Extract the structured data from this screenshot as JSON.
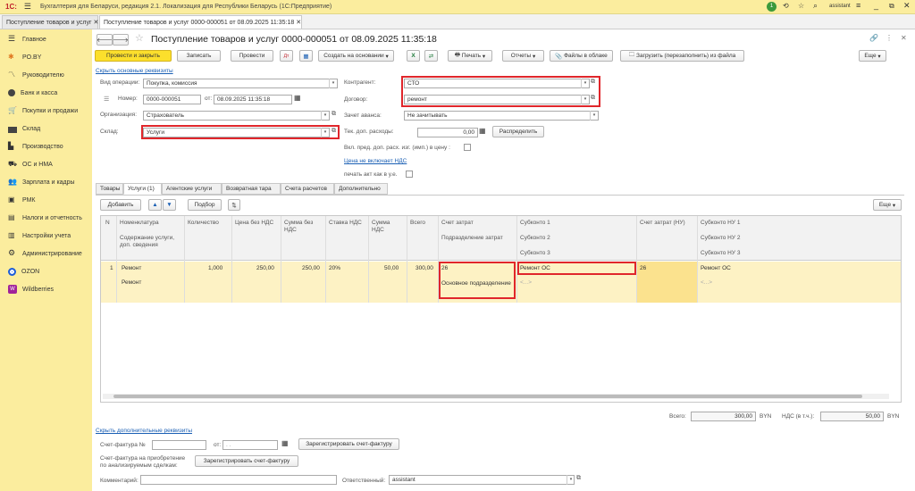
{
  "app": {
    "logo": "1С:",
    "title": "Бухгалтерия для Беларуси, редакция 2.1. Локализация для Республики Беларусь   (1С:Предприятие)",
    "user": "assistant",
    "notifications": "1"
  },
  "window_tabs": [
    {
      "label": "Поступление товаров и услуг"
    },
    {
      "label": "Поступление товаров и услуг 0000-000051 от 08.09.2025 11:35:18"
    }
  ],
  "sidebar": {
    "items": [
      {
        "label": "Главное",
        "icon": "menu-icon"
      },
      {
        "label": "PO.BY",
        "icon": "po-icon"
      },
      {
        "label": "Руководителю",
        "icon": "chart-icon"
      },
      {
        "label": "Банк и касса",
        "icon": "bank-icon"
      },
      {
        "label": "Покупки и продажи",
        "icon": "cart-icon"
      },
      {
        "label": "Склад",
        "icon": "warehouse-icon"
      },
      {
        "label": "Производство",
        "icon": "factory-icon"
      },
      {
        "label": "ОС и НМА",
        "icon": "truck-icon"
      },
      {
        "label": "Зарплата и кадры",
        "icon": "people-icon"
      },
      {
        "label": "РМК",
        "icon": "cashier-icon"
      },
      {
        "label": "Налоги и отчетность",
        "icon": "tax-icon"
      },
      {
        "label": "Настройки учета",
        "icon": "settings-doc-icon"
      },
      {
        "label": "Администрирование",
        "icon": "gear-icon"
      },
      {
        "label": "OZON",
        "icon": "ozon-icon"
      },
      {
        "label": "Wildberries",
        "icon": "wildberries-icon"
      }
    ]
  },
  "doc": {
    "title": "Поступление товаров и услуг 0000-000051 от 08.09.2025 11:35:18",
    "toolbar": {
      "post_close": "Провести и закрыть",
      "save": "Записать",
      "post": "Провести",
      "create_based": "Создать на основании",
      "print": "Печать",
      "reports": "Отчеты",
      "cloud": "Файлы в облаке",
      "load": "Загрузить (перезаполнить) из файла",
      "more": "Еще"
    },
    "hide_main": "Скрыть основные реквизиты",
    "fields": {
      "op_type_label": "Вид операции:",
      "op_type": "Покупка, комиссия",
      "number_label": "Номер:",
      "number": "0000-000051",
      "date_label": "от:",
      "date": "08.09.2025 11:35:18",
      "org_label": "Организация:",
      "org": "Страхователь",
      "warehouse_label": "Склад:",
      "warehouse": "Услуги",
      "contractor_label": "Контрагент:",
      "contractor": "СТО",
      "contract_label": "Договор:",
      "contract": "ремонт",
      "advance_label": "Зачет аванса:",
      "advance": "Не зачитывать",
      "extra_cost_label": "Тек. доп. расходы:",
      "extra_cost": "0,00",
      "distribute": "Распределить",
      "include_label": "Вкл. пред. доп. расх. изг. (имп.) в цену :",
      "vat_link": "Цена не включает НДС",
      "print_act_label": "печать акт как в у.е."
    },
    "tabs": [
      "Товары",
      "Услуги (1)",
      "Агентские услуги",
      "Возвратная тара",
      "Счета расчетов",
      "Дополнительно"
    ],
    "table_toolbar": {
      "add": "Добавить",
      "select": "Подбор",
      "more": "Еще"
    },
    "columns": {
      "n": "N",
      "nom": "Номенклатура",
      "nom2": "Содержание услуги, доп. сведения",
      "qty": "Количество",
      "price": "Цена без НДС",
      "sum": "Сумма без НДС",
      "rate": "Ставка НДС",
      "vat": "Сумма НДС",
      "total": "Всего",
      "acc": "Счет затрат",
      "dept": "Подразделение затрат",
      "sub1": "Субконто 1",
      "sub2": "Субконто 2",
      "sub3": "Субконто 3",
      "acc_nu": "Счет затрат (НУ)",
      "snu1": "Субконто НУ 1",
      "snu2": "Субконто НУ 2",
      "snu3": "Субконто НУ 3"
    },
    "row": {
      "n": "1",
      "nom": "Ремонт",
      "nom2": "Ремонт",
      "qty": "1,000",
      "price": "250,00",
      "sum": "250,00",
      "rate": "20%",
      "vat": "50,00",
      "total": "300,00",
      "acc": "26",
      "dept": "Основное подразделение",
      "sub1": "Ремонт ОС",
      "sub2": "<...>",
      "acc_nu": "26",
      "snu1": "Ремонт ОС",
      "snu2": "<...>"
    },
    "totals": {
      "total_label": "Всего:",
      "total": "300,00",
      "cur": "BYN",
      "vat_label": "НДС (в т.ч.):",
      "vat": "50,00",
      "cur2": "BYN"
    },
    "hide_extra": "Скрыть дополнительные реквизиты",
    "invoice": {
      "label": "Счет-фактура №",
      "date_label": "от:",
      "date": ". .",
      "register": "Зарегистрировать счет-фактуру"
    },
    "invoice2": {
      "label1": "Счет-фактура на приобретение",
      "label2": "по анализируемым сделкам:",
      "register": "Зарегистрировать счет-фактуру"
    },
    "comment_label": "Комментарий:",
    "responsible_label": "Ответственный:",
    "responsible": "assistant"
  }
}
